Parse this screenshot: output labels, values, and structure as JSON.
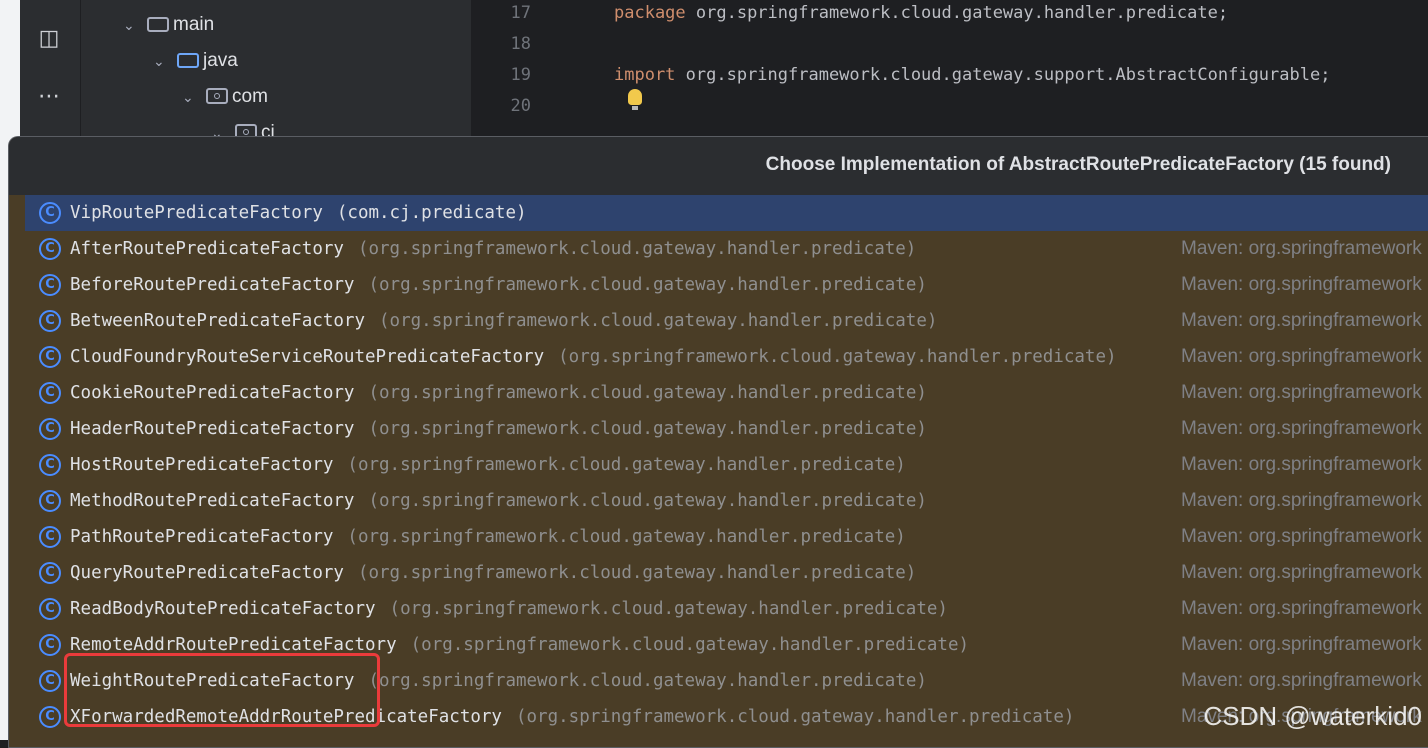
{
  "project_tree": [
    {
      "label": "main",
      "icon": "folder-icon"
    },
    {
      "label": "java",
      "icon": "source-folder-icon"
    },
    {
      "label": "com",
      "icon": "package-icon"
    },
    {
      "label": "cj",
      "icon": "package-icon"
    }
  ],
  "toolbar": {
    "structure_icon": "structure-icon",
    "more_icon": "more-icon"
  },
  "editor": {
    "lines": [
      {
        "num": "17",
        "keyword": "package",
        "text": " org.springframework.cloud.gateway.handler.predicate;"
      },
      {
        "num": "18",
        "keyword": "",
        "text": ""
      },
      {
        "num": "19",
        "keyword": "import",
        "text": " org.springframework.cloud.gateway.support.AbstractConfigurable;"
      },
      {
        "num": "20",
        "keyword": "",
        "text": ""
      }
    ]
  },
  "popup": {
    "title": "Choose Implementation of AbstractRoutePredicateFactory (15 found)",
    "items": [
      {
        "name": "VipRoutePredicateFactory",
        "pkg": "(com.cj.predicate)",
        "source": "",
        "selected": true
      },
      {
        "name": "AfterRoutePredicateFactory",
        "pkg": "(org.springframework.cloud.gateway.handler.predicate)",
        "source": "Maven: org.springframework"
      },
      {
        "name": "BeforeRoutePredicateFactory",
        "pkg": "(org.springframework.cloud.gateway.handler.predicate)",
        "source": "Maven: org.springframework"
      },
      {
        "name": "BetweenRoutePredicateFactory",
        "pkg": "(org.springframework.cloud.gateway.handler.predicate)",
        "source": "Maven: org.springframework"
      },
      {
        "name": "CloudFoundryRouteServiceRoutePredicateFactory",
        "pkg": "(org.springframework.cloud.gateway.handler.predicate)",
        "source": "Maven: org.springframework"
      },
      {
        "name": "CookieRoutePredicateFactory",
        "pkg": "(org.springframework.cloud.gateway.handler.predicate)",
        "source": "Maven: org.springframework"
      },
      {
        "name": "HeaderRoutePredicateFactory",
        "pkg": "(org.springframework.cloud.gateway.handler.predicate)",
        "source": "Maven: org.springframework"
      },
      {
        "name": "HostRoutePredicateFactory",
        "pkg": "(org.springframework.cloud.gateway.handler.predicate)",
        "source": "Maven: org.springframework"
      },
      {
        "name": "MethodRoutePredicateFactory",
        "pkg": "(org.springframework.cloud.gateway.handler.predicate)",
        "source": "Maven: org.springframework"
      },
      {
        "name": "PathRoutePredicateFactory",
        "pkg": "(org.springframework.cloud.gateway.handler.predicate)",
        "source": "Maven: org.springframework"
      },
      {
        "name": "QueryRoutePredicateFactory",
        "pkg": "(org.springframework.cloud.gateway.handler.predicate)",
        "source": "Maven: org.springframework"
      },
      {
        "name": "ReadBodyRoutePredicateFactory",
        "pkg": "(org.springframework.cloud.gateway.handler.predicate)",
        "source": "Maven: org.springframework"
      },
      {
        "name": "RemoteAddrRoutePredicateFactory",
        "pkg": "(org.springframework.cloud.gateway.handler.predicate)",
        "source": "Maven: org.springframework"
      },
      {
        "name": "WeightRoutePredicateFactory",
        "pkg": "(org.springframework.cloud.gateway.handler.predicate)",
        "source": "Maven: org.springframework"
      },
      {
        "name": "XForwardedRemoteAddrRoutePredicateFactory",
        "pkg": "(org.springframework.cloud.gateway.handler.predicate)",
        "source": "Maven: org.springframework"
      }
    ]
  },
  "watermark": "CSDN @waterkid0",
  "colors": {
    "accent": "#4a8cff",
    "selected_row": "#2e436e",
    "popup_bg": "#4a3d26",
    "highlight_box": "#ea3b3b"
  }
}
